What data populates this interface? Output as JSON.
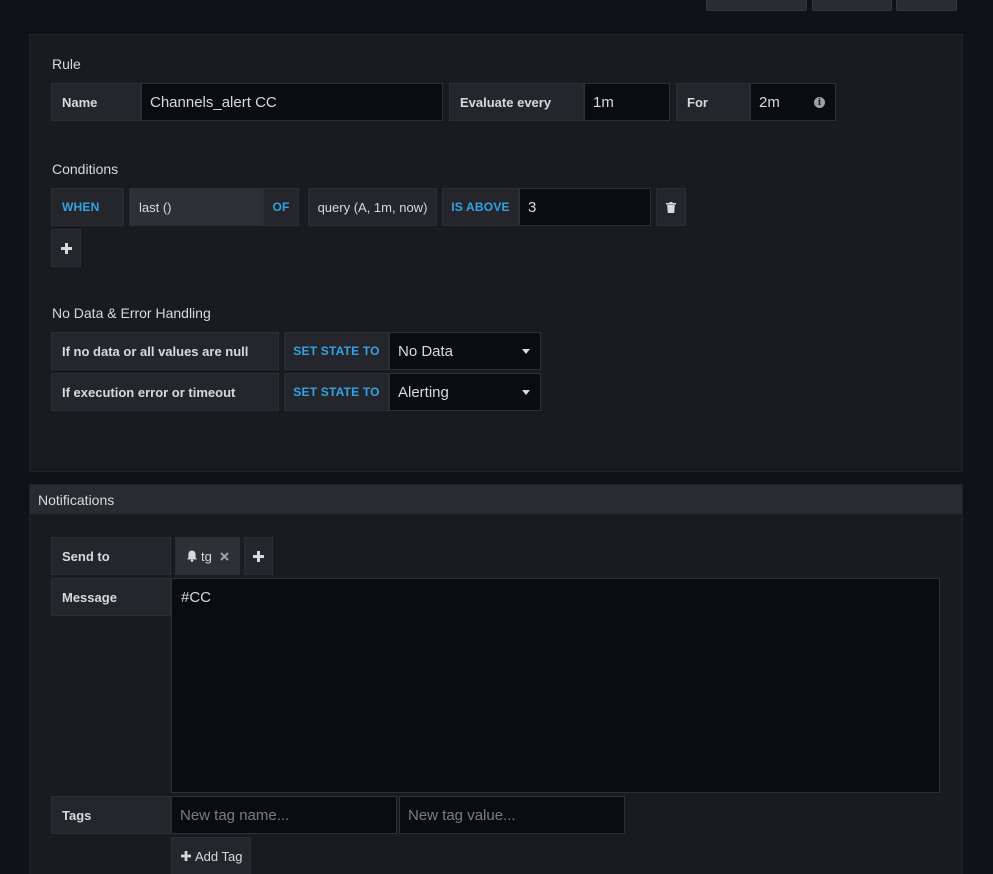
{
  "rule": {
    "title": "Rule",
    "name_label": "Name",
    "name_value": "Channels_alert CC",
    "evaluate_label": "Evaluate every",
    "evaluate_value": "1m",
    "for_label": "For",
    "for_value": "2m"
  },
  "conditions": {
    "title": "Conditions",
    "when": "WHEN",
    "reducer": "last ()",
    "of": "OF",
    "query": "query (A, 1m, now)",
    "evaluator": "IS ABOVE",
    "threshold": "3"
  },
  "no_data": {
    "title": "No Data & Error Handling",
    "rows": [
      {
        "label": "If no data or all values are null",
        "action": "SET STATE TO",
        "value": "No Data"
      },
      {
        "label": "If execution error or timeout",
        "action": "SET STATE TO",
        "value": "Alerting"
      }
    ]
  },
  "notifications": {
    "title": "Notifications",
    "send_to_label": "Send to",
    "channel": "tg",
    "message_label": "Message",
    "message_value": "#CC",
    "tags_label": "Tags",
    "tag_name_placeholder": "New tag name...",
    "tag_value_placeholder": "New tag value...",
    "add_tag_label": "Add Tag"
  },
  "colors": {
    "accent": "#33a2e5",
    "background": "#111217",
    "panel": "#1a1b1f"
  }
}
